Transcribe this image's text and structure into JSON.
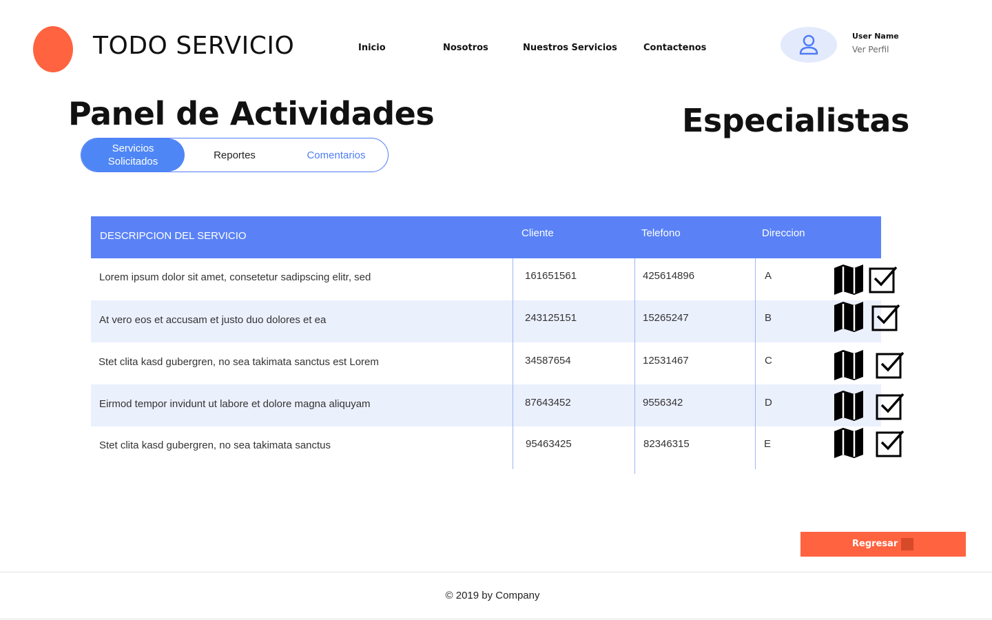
{
  "brand": {
    "name": "TODO SERVICIO",
    "logo_color": "#ff6340"
  },
  "nav": {
    "items": [
      {
        "label": "Inicio"
      },
      {
        "label": "Nosotros"
      },
      {
        "label": "Nuestros Servicios"
      },
      {
        "label": "Contactenos"
      }
    ]
  },
  "user": {
    "name": "User Name",
    "profile_link": "Ver Perfil",
    "icon": "user-icon"
  },
  "page": {
    "title": "Panel de Actividades",
    "side_title": "Especialistas"
  },
  "tabs": [
    {
      "label": "Servicios Solicitados",
      "active": true
    },
    {
      "label": "Reportes",
      "active": false
    },
    {
      "label": "Comentarios",
      "active": false
    }
  ],
  "table": {
    "headers": [
      "DESCRIPCION DEL SERVICIO",
      "Cliente",
      "Telefono",
      "Direccion"
    ],
    "rows": [
      {
        "descripcion": "Lorem ipsum dolor sit amet, consetetur sadipscing elitr, sed",
        "cliente": "161651561",
        "telefono": "425614896",
        "direccion": "A"
      },
      {
        "descripcion": "At vero eos et accusam et justo duo dolores et ea",
        "cliente": "243125151",
        "telefono": "15265247",
        "direccion": "B"
      },
      {
        "descripcion": "Stet clita kasd gubergren, no sea takimata sanctus est Lorem",
        "cliente": "34587654",
        "telefono": "12531467",
        "direccion": "C"
      },
      {
        "descripcion": "Eirmod tempor invidunt ut labore et dolore magna aliquyam",
        "cliente": "87643452",
        "telefono": "9556342",
        "direccion": "D"
      },
      {
        "descripcion": "Stet clita kasd gubergren, no sea takimata sanctus",
        "cliente": "95463425",
        "telefono": "82346315",
        "direccion": "E"
      }
    ],
    "row_icons": [
      "map-icon",
      "checkbox-checked-icon"
    ]
  },
  "actions": {
    "back_label": "Regresar"
  },
  "footer": {
    "copyright": "© 2019 by Company"
  },
  "colors": {
    "accent": "#4e86f5",
    "header_bg": "#5a82f6",
    "row_alt_bg": "#ebf0fd",
    "button": "#ff6340"
  }
}
